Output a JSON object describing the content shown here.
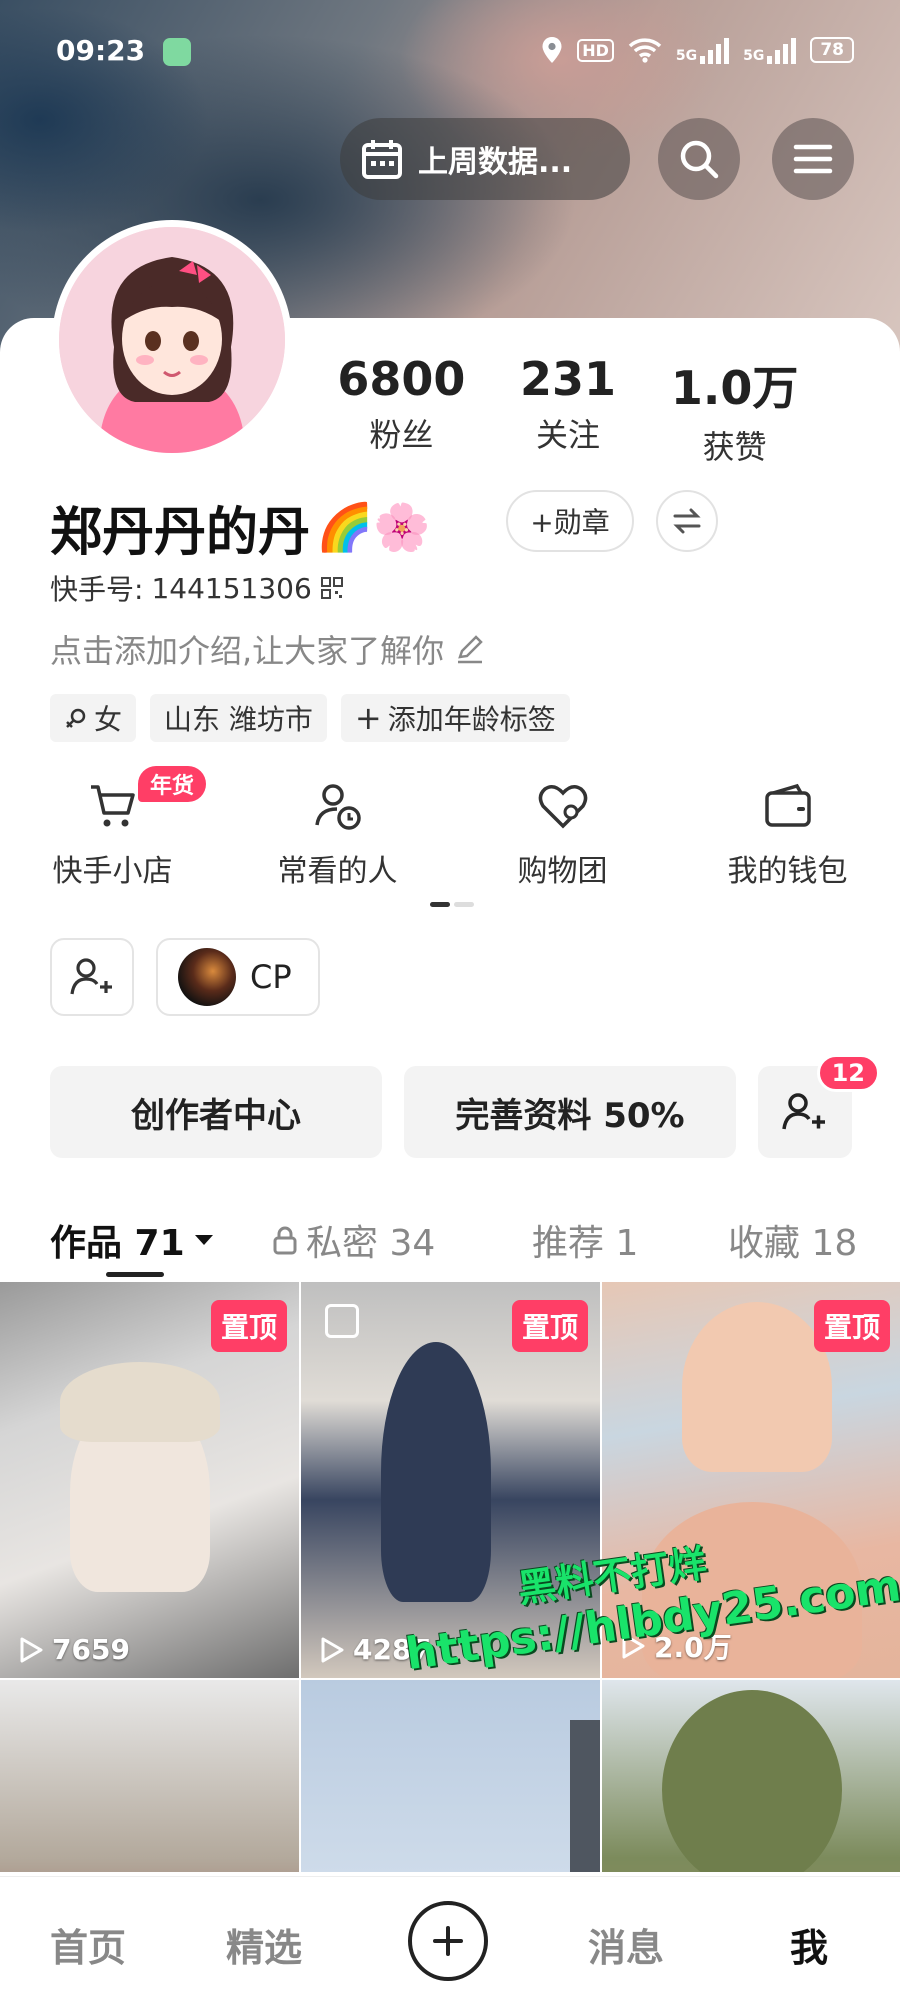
{
  "status_bar": {
    "time": "09:23",
    "network_1": "5G",
    "network_2": "5G",
    "hd": "HD",
    "battery": "78"
  },
  "header": {
    "last_week_label": "上周数据...",
    "search_icon": "search-icon",
    "menu_icon": "menu-icon"
  },
  "profile": {
    "name": "郑丹丹的丹",
    "emojis": "🌈🌸",
    "badge_button": "+勋章",
    "kuaishou_id_label": "快手号:",
    "kuaishou_id": "144151306",
    "bio_placeholder": "点击添加介绍,让大家了解你",
    "tags": [
      "女",
      "山东 潍坊市",
      "添加年龄标签"
    ],
    "stats": [
      {
        "value": "6800",
        "label": "粉丝"
      },
      {
        "value": "231",
        "label": "关注"
      },
      {
        "value": "1.0万",
        "label": "获赞"
      }
    ]
  },
  "services": [
    {
      "label": "快手小店",
      "icon": "cart-icon",
      "badge": "年货"
    },
    {
      "label": "常看的人",
      "icon": "person-clock-icon",
      "badge": ""
    },
    {
      "label": "购物团",
      "icon": "heart-group-icon",
      "badge": ""
    },
    {
      "label": "我的钱包",
      "icon": "wallet-icon",
      "badge": ""
    }
  ],
  "cp": {
    "label": "CP"
  },
  "actions": {
    "creator_center": "创作者中心",
    "complete_profile": "完善资料 50%",
    "friend_requests": "12"
  },
  "tabs": [
    {
      "label": "作品 71",
      "active": true
    },
    {
      "label": "私密 34",
      "active": false
    },
    {
      "label": "推荐 1",
      "active": false
    },
    {
      "label": "收藏 18",
      "active": false
    }
  ],
  "grid": [
    {
      "pinned": "置顶",
      "plays": "7659"
    },
    {
      "pinned": "置顶",
      "plays": "4287"
    },
    {
      "pinned": "置顶",
      "plays": "2.0万"
    },
    {
      "pinned": "",
      "plays": ""
    },
    {
      "pinned": "",
      "plays": ""
    },
    {
      "pinned": "",
      "plays": ""
    }
  ],
  "watermark": {
    "line1": "黑料不打烊",
    "line2": "https://hlbdy25.com"
  },
  "bottom_nav": [
    {
      "label": "首页",
      "active": false
    },
    {
      "label": "精选",
      "active": false
    },
    {
      "label": "消息",
      "active": false
    },
    {
      "label": "我",
      "active": true
    }
  ],
  "colors": {
    "accent": "#ff3e66",
    "watermark": "#19e36a"
  }
}
